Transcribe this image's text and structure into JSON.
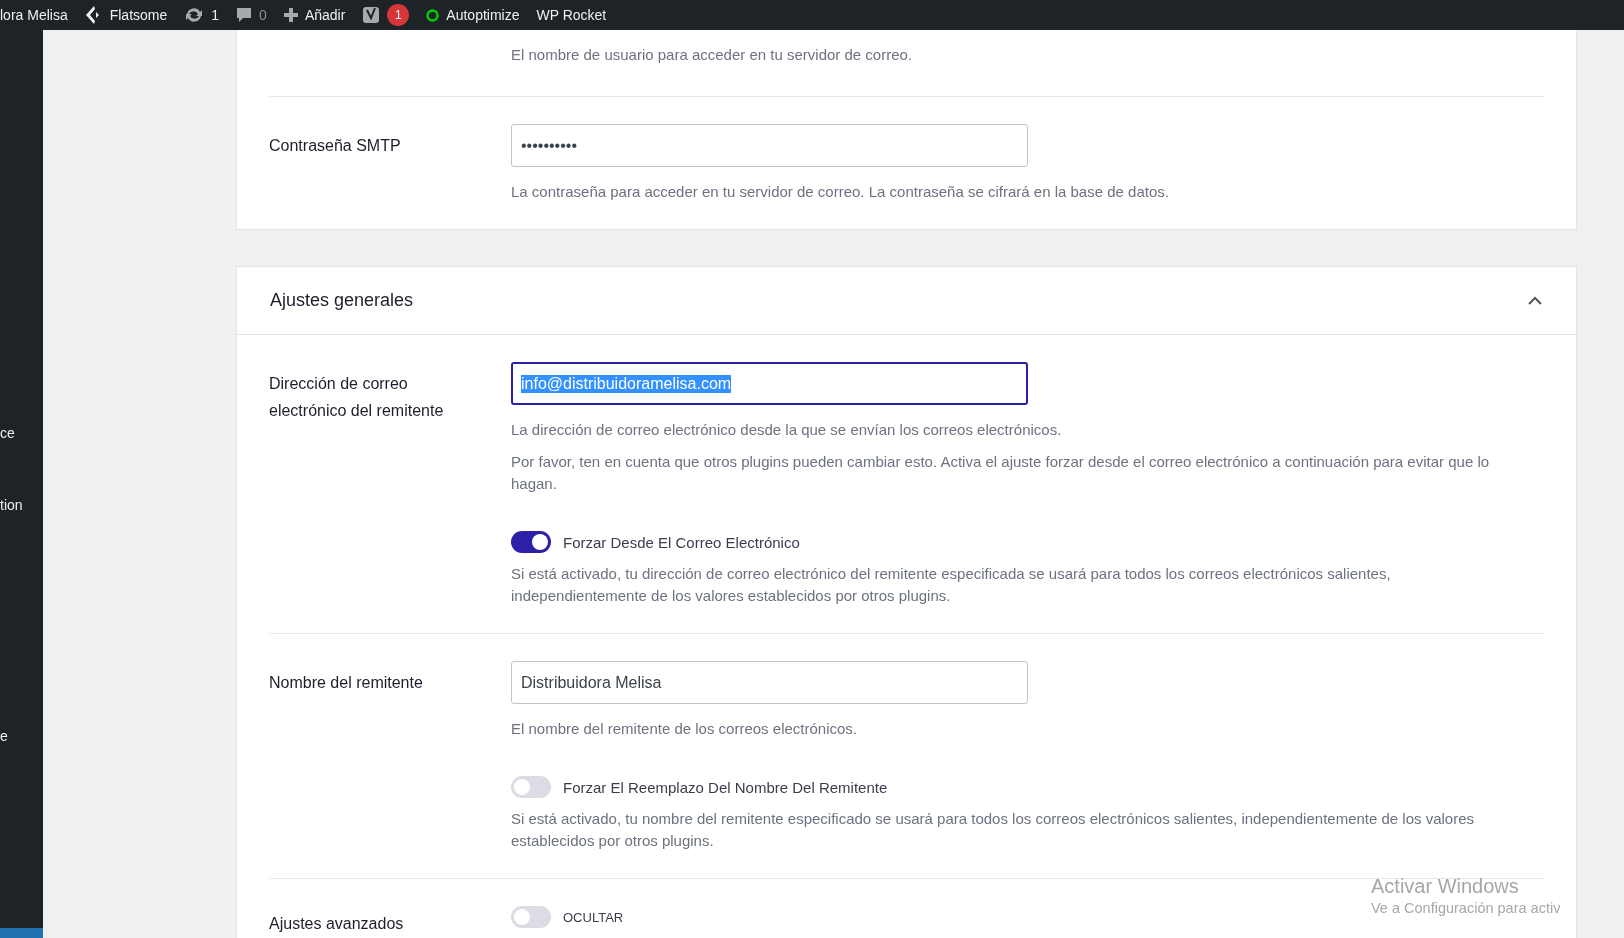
{
  "admin_bar": {
    "items": [
      {
        "kind": "text",
        "label": "lora Melisa"
      },
      {
        "kind": "flatsome",
        "label": "Flatsome"
      },
      {
        "kind": "updates",
        "label": "1"
      },
      {
        "kind": "comments",
        "label": "0"
      },
      {
        "kind": "add",
        "label": "Añadir"
      },
      {
        "kind": "yoast",
        "badge": "1"
      },
      {
        "kind": "status",
        "label": "Autoptimize"
      },
      {
        "kind": "text",
        "label": "WP Rocket"
      }
    ]
  },
  "sidebar": {
    "items": [
      {
        "label": "ce"
      },
      {
        "label": "tion"
      },
      {
        "label": "e"
      }
    ]
  },
  "smtp_card": {
    "rows": [
      {
        "kind": "tail",
        "description": "El nombre de usuario para acceder en tu servidor de correo."
      },
      {
        "kind": "field",
        "label": "Contraseña SMTP",
        "value": "••••••••••",
        "focused": false,
        "selected_text": false,
        "descriptions": [
          "La contraseña para acceder en tu servidor de correo. La contraseña se cifrará en la base de datos."
        ]
      }
    ]
  },
  "general_card": {
    "title": "Ajustes generales",
    "expanded": true,
    "rows": [
      {
        "kind": "field",
        "label": "Dirección de correo electrónico del remitente",
        "value": "info@distribuidoramelisa.com",
        "focused": true,
        "selected_text": true,
        "descriptions": [
          "La dirección de correo electrónico desde la que se envían los correos electrónicos.",
          "Por favor, ten en cuenta que otros plugins pueden cambiar esto. Activa el ajuste forzar desde el correo electrónico a continuación para evitar que lo hagan."
        ],
        "toggle": {
          "label": "Forzar Desde El Correo Electrónico",
          "on": true,
          "description": "Si está activado, tu dirección de correo electrónico del remitente especificada se usará para todos los correos electrónicos salientes, independientemente de los valores establecidos por otros plugins."
        }
      },
      {
        "kind": "field",
        "label": "Nombre del remitente",
        "value": "Distribuidora Melisa",
        "focused": false,
        "selected_text": false,
        "descriptions": [
          "El nombre del remitente de los correos electrónicos."
        ],
        "toggle": {
          "label": "Forzar El Reemplazo Del Nombre Del Remitente",
          "on": false,
          "description": "Si está activado, tu nombre del remitente especificado se usará para todos los correos electrónicos salientes, independientemente de los valores establecidos por otros plugins."
        }
      },
      {
        "kind": "switch",
        "label": "Ajustes avanzados",
        "toggle": {
          "label": "OCULTAR",
          "on": false
        }
      }
    ]
  },
  "windows_notice": {
    "title": "Activar Windows",
    "subtitle": "Ve a Configuración para activ"
  }
}
